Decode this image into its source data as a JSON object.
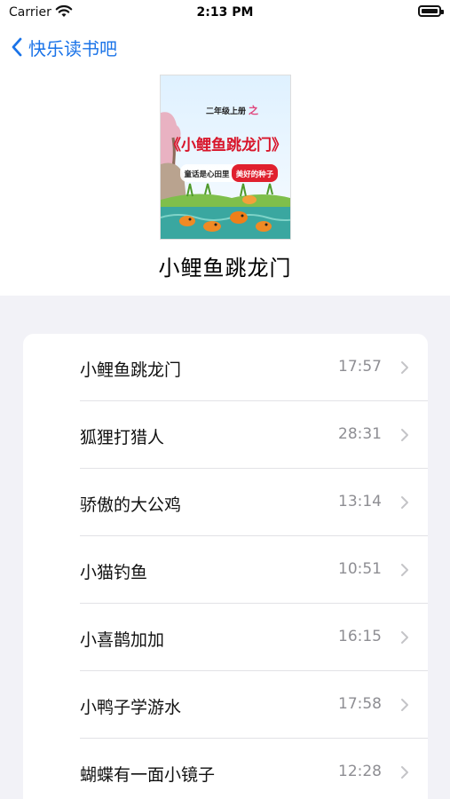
{
  "status_bar": {
    "carrier": "Carrier",
    "time": "2:13 PM"
  },
  "nav": {
    "back_label": "快乐读书吧"
  },
  "book": {
    "title": "小鲤鱼跳龙门",
    "cover": {
      "grade_text": "二年级上册",
      "zhi": "之",
      "title": "《小鲤鱼跳龙门》",
      "slogan_left": "童话是心田里",
      "slogan_right": "美好的种子"
    }
  },
  "chapters": [
    {
      "name": "小鲤鱼跳龙门",
      "duration": "17:57"
    },
    {
      "name": "狐狸打猎人",
      "duration": "28:31"
    },
    {
      "name": "骄傲的大公鸡",
      "duration": "13:14"
    },
    {
      "name": "小猫钓鱼",
      "duration": "10:51"
    },
    {
      "name": "小喜鹊加加",
      "duration": "16:15"
    },
    {
      "name": "小鸭子学游水",
      "duration": "17:58"
    },
    {
      "name": "蝴蝶有一面小镜子",
      "duration": "12:28"
    }
  ],
  "colors": {
    "accent": "#1a73e8",
    "background": "#f2f2f7",
    "secondary_text": "#8e8e93"
  }
}
